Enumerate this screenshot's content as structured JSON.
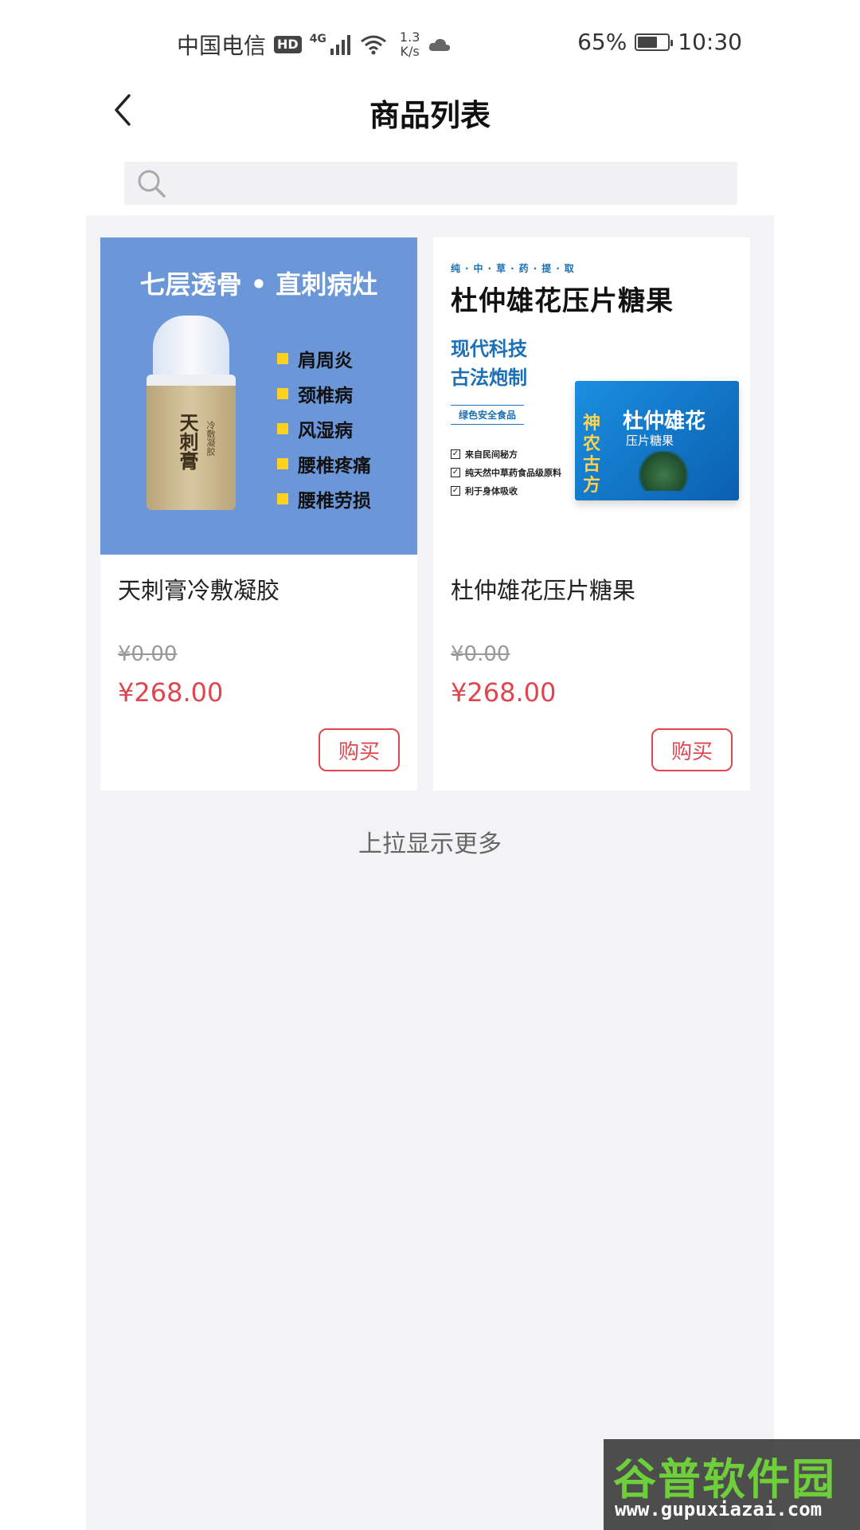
{
  "status_bar": {
    "carrier": "中国电信",
    "hd": "HD",
    "network": "4G",
    "speed_value": "1.3",
    "speed_unit": "K/s",
    "battery_percent": "65%",
    "battery_level": 0.65,
    "time": "10:30",
    "icons": [
      "signal-icon",
      "wifi-icon",
      "cloud-icon",
      "battery-icon"
    ]
  },
  "header": {
    "title": "商品列表",
    "back_icon": "chevron-left-icon"
  },
  "search": {
    "placeholder": "",
    "icon": "search-icon"
  },
  "products": [
    {
      "name": "天刺膏冷敷凝胶",
      "original_price": "¥0.00",
      "price": "¥268.00",
      "buy_label": "购买",
      "image": {
        "headline": "七层透骨 • 直刺病灶",
        "bottle_label": "天刺膏",
        "bottle_sublabel": "冷敷凝胶",
        "features": [
          "肩周炎",
          "颈椎病",
          "风湿病",
          "腰椎疼痛",
          "腰椎劳损"
        ]
      }
    },
    {
      "name": "杜仲雄花压片糖果",
      "original_price": "¥0.00",
      "price": "¥268.00",
      "buy_label": "购买",
      "image": {
        "tagline": "纯·中·草·药·提·取",
        "title": "杜仲雄花压片糖果",
        "slogan_1": "现代科技",
        "slogan_2": "古法炮制",
        "badge": "绿色安全食品",
        "checks": [
          "来自民间秘方",
          "纯天然中草药食品级原料",
          "利于身体吸收"
        ],
        "box_brand": "神农古方",
        "box_name": "杜仲雄花",
        "box_sub": "压片糖果"
      }
    }
  ],
  "load_more_text": "上拉显示更多",
  "watermark": {
    "logo": "谷普软件园",
    "url": "www.gupuxiazai.com"
  },
  "colors": {
    "accent": "#e0464e",
    "background": "#f3f3f6",
    "product1_bg": "#6b97d8",
    "brand_blue": "#1e6fb3"
  }
}
